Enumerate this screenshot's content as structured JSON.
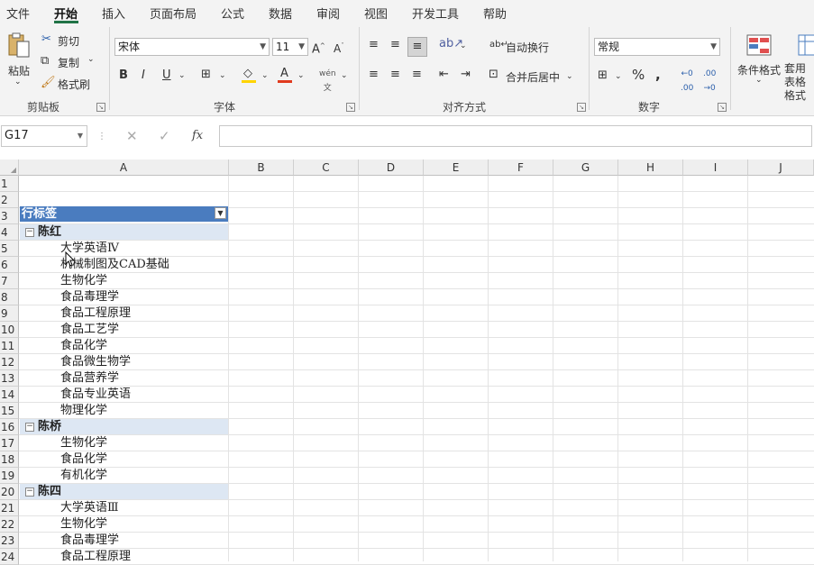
{
  "menu": [
    "文件",
    "开始",
    "插入",
    "页面布局",
    "公式",
    "数据",
    "审阅",
    "视图",
    "开发工具",
    "帮助"
  ],
  "ribbon": {
    "clipboard": {
      "paste": "粘贴",
      "cut": "剪切",
      "copy": "复制",
      "format_painter": "格式刷",
      "group": "剪贴板"
    },
    "font": {
      "name": "宋体",
      "size": "11",
      "group": "字体"
    },
    "alignment": {
      "wrap": "自动换行",
      "merge": "合并后居中",
      "group": "对齐方式"
    },
    "number": {
      "format": "常规",
      "group": "数字"
    },
    "styles": {
      "conditional": "条件格式",
      "table_format": "套用表格格式"
    }
  },
  "formula_bar": {
    "name_box": "G17",
    "fx": "fx",
    "formula": ""
  },
  "columns": [
    "A",
    "B",
    "C",
    "D",
    "E",
    "F",
    "G",
    "H",
    "I",
    "J"
  ],
  "rows": [
    "1",
    "2",
    "3",
    "4",
    "5",
    "6",
    "7",
    "8",
    "9",
    "10",
    "11",
    "12",
    "13",
    "14",
    "15",
    "16",
    "17",
    "18",
    "19",
    "20",
    "21",
    "22",
    "23",
    "24"
  ],
  "pivot": {
    "header": "行标签",
    "groups": [
      {
        "name": "陈红",
        "items": [
          "大学英语Ⅳ",
          "机械制图及CAD基础",
          "生物化学",
          "食品毒理学",
          "食品工程原理",
          "食品工艺学",
          "食品化学",
          "食品微生物学",
          "食品营养学",
          "食品专业英语",
          "物理化学"
        ]
      },
      {
        "name": "陈桥",
        "items": [
          "生物化学",
          "食品化学",
          "有机化学"
        ]
      },
      {
        "name": "陈四",
        "items": [
          "大学英语Ⅲ",
          "生物化学",
          "食品毒理学",
          "食品工程原理"
        ]
      }
    ]
  }
}
